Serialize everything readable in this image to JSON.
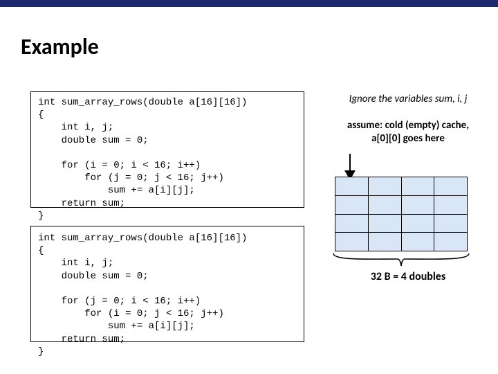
{
  "title": "Example",
  "code_a": "int sum_array_rows(double a[16][16])\n{\n    int i, j;\n    double sum = 0;\n\n    for (i = 0; i < 16; i++)\n        for (j = 0; j < 16; j++)\n            sum += a[i][j];\n    return sum;\n}",
  "code_b": "int sum_array_rows(double a[16][16])\n{\n    int i, j;\n    double sum = 0;\n\n    for (j = 0; i < 16; i++)\n        for (i = 0; j < 16; j++)\n            sum += a[i][j];\n    return sum;\n}",
  "note1": "Ignore the variables sum, i, j",
  "note2_line1": "assume: cold (empty) cache,",
  "note2_line2": "a[0][0] goes here",
  "caption": "32 B = 4 doubles",
  "cache": {
    "rows": 4,
    "cols": 4
  }
}
